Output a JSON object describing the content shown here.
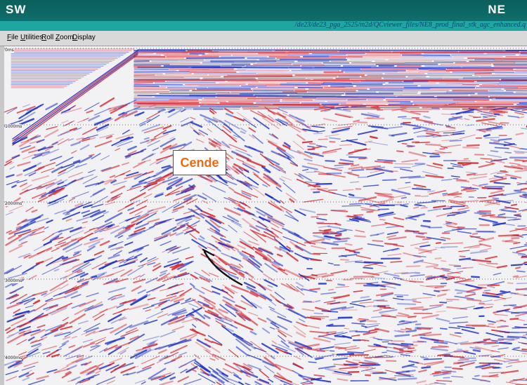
{
  "directions": {
    "left": "SW",
    "right": "NE"
  },
  "window": {
    "path": "/de23/de23_pga_2525/m2d/QCviewer_files/NE8_prod_final_stk_agc_enhanced.q"
  },
  "menu": [
    {
      "label": "File",
      "mnemonic": "F",
      "rest": "ile"
    },
    {
      "label": "Utilities",
      "mnemonic": "U",
      "rest": "tilities"
    },
    {
      "label": "Roll",
      "mnemonic": "R",
      "rest": "oll"
    },
    {
      "label": "Zoom",
      "mnemonic": "Z",
      "rest": "oom"
    },
    {
      "label": "Display",
      "mnemonic": "D",
      "rest": "isplay"
    }
  ],
  "time_axis": {
    "ticks": [
      "0ms",
      "1000ms",
      "2000ms",
      "3000ms",
      "4000ms"
    ]
  },
  "annotations": {
    "label": "Cende"
  },
  "colors": {
    "positive": "#1b2fc4",
    "negative": "#d4232a",
    "background": "#f2f2f5"
  }
}
